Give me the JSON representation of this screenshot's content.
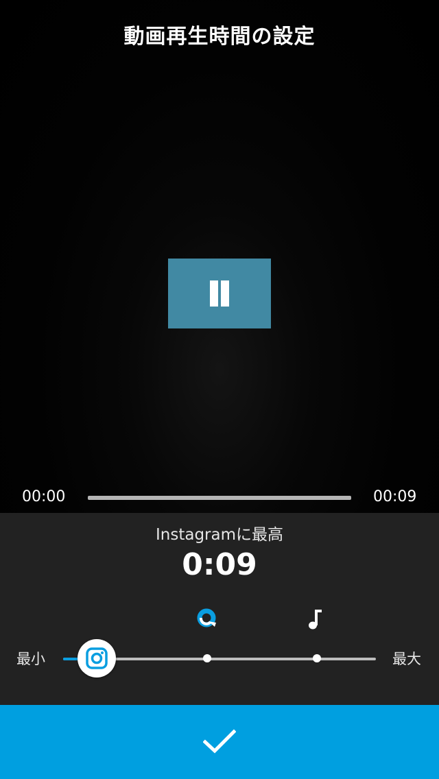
{
  "header": {
    "title": "動画再生時間の設定"
  },
  "player": {
    "current_time": "00:00",
    "total_time": "00:09",
    "state": "playing",
    "control_icon": "pause-icon",
    "progress": 0.0
  },
  "duration_panel": {
    "preset_label": "Instagramに最高",
    "duration": "0:09",
    "min_label": "最小",
    "max_label": "最大",
    "presets": [
      {
        "icon": "instagram-icon",
        "selected": true
      },
      {
        "icon": "quik-icon",
        "selected": false
      },
      {
        "icon": "music-note-icon",
        "selected": false
      }
    ],
    "accent_color": "#0a9ee0"
  },
  "confirm": {
    "icon": "checkmark-icon",
    "color": "#009fe0"
  }
}
